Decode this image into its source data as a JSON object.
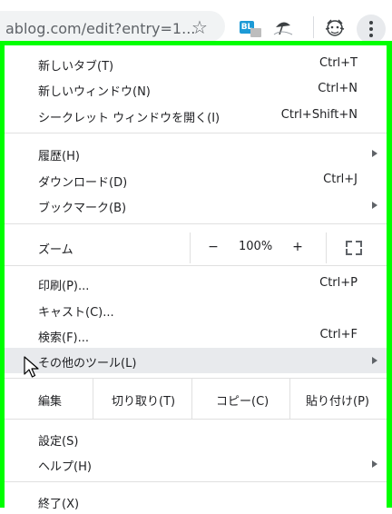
{
  "toolbar": {
    "url": "ablog.com/edit?entry=1...",
    "star_icon": "☆",
    "ext1_label": "BL"
  },
  "menu": {
    "new_tab": {
      "label": "新しいタブ(T)",
      "shortcut": "Ctrl+T"
    },
    "new_window": {
      "label": "新しいウィンドウ(N)",
      "shortcut": "Ctrl+N"
    },
    "incognito": {
      "label": "シークレット ウィンドウを開く(I)",
      "shortcut": "Ctrl+Shift+N"
    },
    "history": {
      "label": "履歴(H)"
    },
    "downloads": {
      "label": "ダウンロード(D)",
      "shortcut": "Ctrl+J"
    },
    "bookmarks": {
      "label": "ブックマーク(B)"
    },
    "zoom": {
      "label": "ズーム",
      "minus": "−",
      "value": "100%",
      "plus": "+"
    },
    "print": {
      "label": "印刷(P)...",
      "shortcut": "Ctrl+P"
    },
    "cast": {
      "label": "キャスト(C)..."
    },
    "find": {
      "label": "検索(F)...",
      "shortcut": "Ctrl+F"
    },
    "more_tools": {
      "label": "その他のツール(L)"
    },
    "edit": {
      "label": "編集",
      "cut": "切り取り(T)",
      "copy": "コピー(C)",
      "paste": "貼り付け(P)"
    },
    "settings": {
      "label": "設定(S)"
    },
    "help": {
      "label": "ヘルプ(H)"
    },
    "exit": {
      "label": "終了(X)"
    }
  },
  "colors": {
    "highlight": "#00ff00",
    "hover": "#e8eaed"
  }
}
